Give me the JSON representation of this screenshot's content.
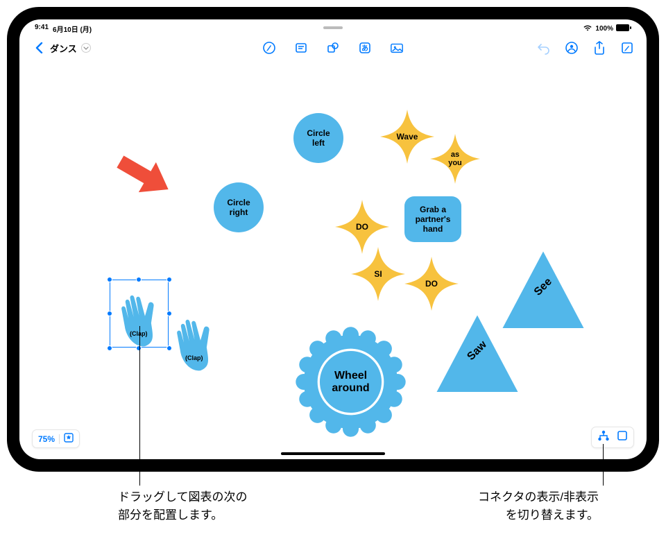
{
  "status": {
    "time": "9:41",
    "date": "6月10日 (月)",
    "wifi": "wifi-icon",
    "battery_pct": "100%"
  },
  "toolbar": {
    "back_icon": "chevron-left-icon",
    "doc_title": "ダンス",
    "dropdown_icon": "chevron-down-icon",
    "center_icons": {
      "draw": "pencil-circle-icon",
      "note": "sticky-note-icon",
      "shape": "shapes-icon",
      "text": "text-a-icon",
      "image": "photo-icon"
    },
    "right_icons": {
      "undo": "undo-icon",
      "collaborate": "collaborate-icon",
      "share": "share-icon",
      "more": "edit-icon"
    }
  },
  "zoom": {
    "value": "75%",
    "star_icon": "star-icon"
  },
  "bottomRight": {
    "connectors_icon": "hierarchy-icon",
    "rect_icon": "rectangle-icon"
  },
  "canvas": {
    "circle_left": "Circle left",
    "circle_right": "Circle right",
    "wave": "Wave",
    "as_you": "as you",
    "do1": "DO",
    "si": "SI",
    "do2": "DO",
    "grab": "Grab a partner's hand",
    "see": "See",
    "saw": "Saw",
    "wheel": "Wheel around",
    "clap1": "(Clap)",
    "clap2": "(Clap)"
  },
  "callouts": {
    "left": "ドラッグして図表の次の\n部分を配置します。",
    "right": "コネクタの表示/非表示\nを切り替えます。"
  },
  "colors": {
    "blue": "#52b7ea",
    "yellow": "#f7c23e",
    "red": "#ef4e3a",
    "system_blue": "#007aff"
  }
}
